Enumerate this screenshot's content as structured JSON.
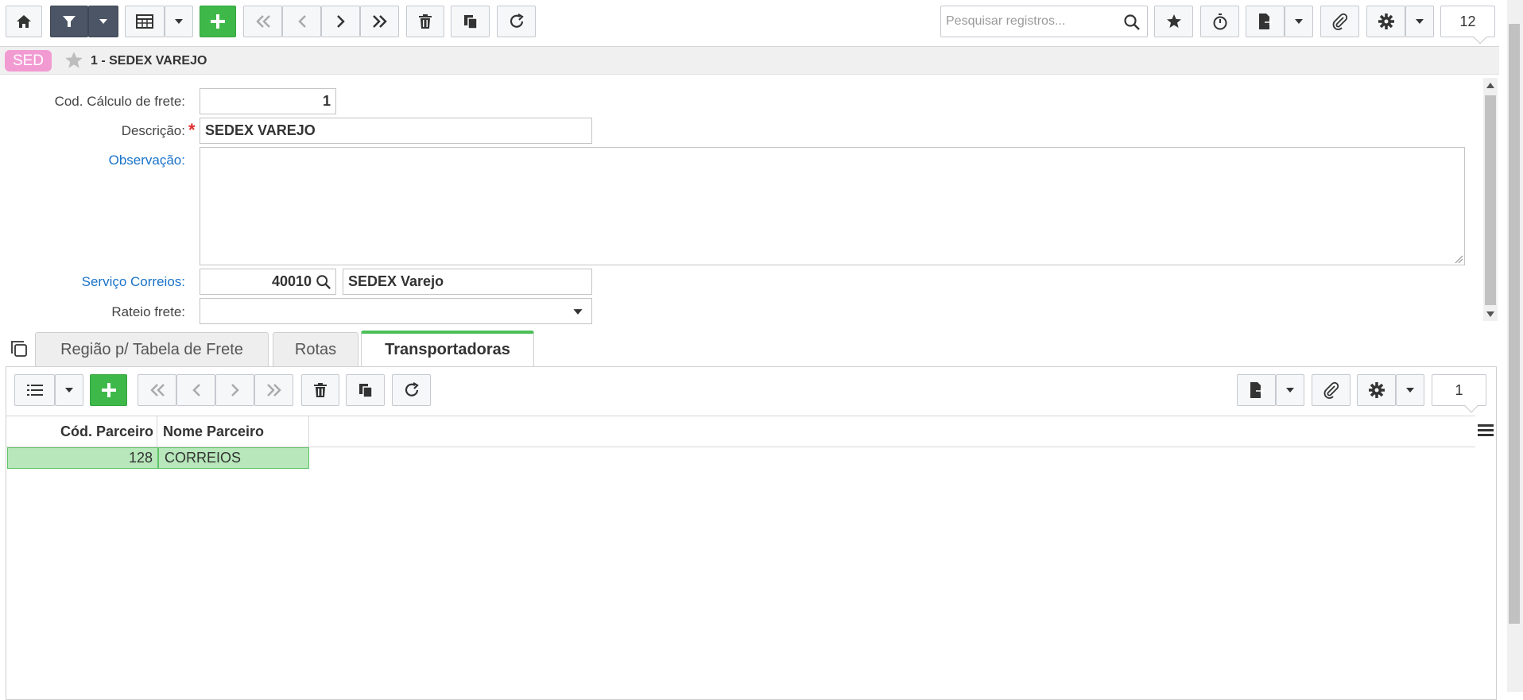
{
  "toolbar": {
    "search_placeholder": "Pesquisar registros...",
    "records_count": "12"
  },
  "record": {
    "badge": "SED",
    "title": "1 - SEDEX VAREJO"
  },
  "form": {
    "cod_calculo": {
      "label": "Cod. Cálculo de frete:",
      "value": "1"
    },
    "descricao": {
      "label": "Descrição:",
      "required": "*",
      "value": "SEDEX VAREJO"
    },
    "observacao": {
      "label": "Observação:",
      "value": ""
    },
    "servico_correios": {
      "label": "Serviço Correios:",
      "code": "40010",
      "name": "SEDEX Varejo"
    },
    "rateio_frete": {
      "label": "Rateio frete:",
      "value": ""
    }
  },
  "tabs": [
    {
      "label": "Região p/ Tabela de Frete"
    },
    {
      "label": "Rotas"
    },
    {
      "label": "Transportadoras"
    }
  ],
  "grid": {
    "records_count": "1",
    "columns": [
      "Cód. Parceiro",
      "Nome Parceiro"
    ],
    "rows": [
      {
        "cod_parceiro": "128",
        "nome_parceiro": "CORREIOS"
      }
    ]
  },
  "colors": {
    "accent_green": "#3fb84a",
    "badge_pink": "#f29ad2",
    "link_blue": "#1a73c9",
    "selected_row": "#b7e7ba"
  }
}
